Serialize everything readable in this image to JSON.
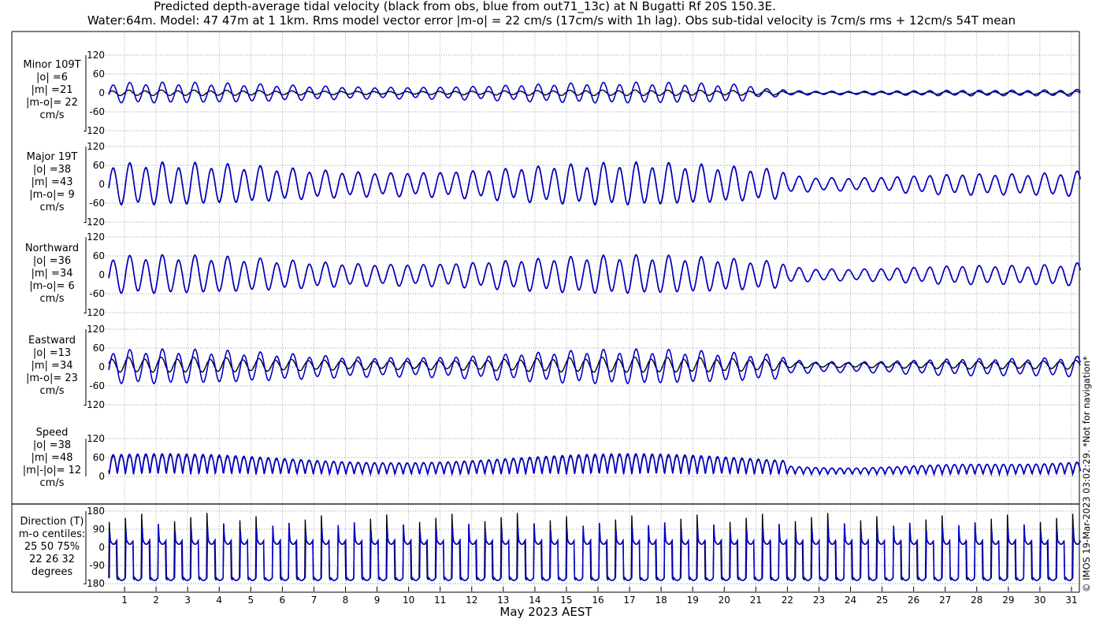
{
  "title_line1": "Predicted depth-average tidal velocity (black from obs, blue from out71_13c) at N Bugatti Rf 20S 150.3E.",
  "title_line2": "Water:64m. Model: 47 47m at 1 1km. Rms model vector error |m-o| = 22 cm/s (17cm/s with 1h lag). Obs sub-tidal velocity is 7cm/s rms + 12cm/s 54T mean",
  "xlabel": "May 2023 AEST",
  "copyright": "© IMOS 19-Mar-2023 03:02:29. *Not for navigation*",
  "colors": {
    "obs": "#000000",
    "model": "#0000cc",
    "grid": "#777777"
  },
  "panels": [
    {
      "label_lines": [
        "Minor 109T",
        "|o| =6",
        "|m| =21",
        "|m-o|= 22",
        "cm/s"
      ]
    },
    {
      "label_lines": [
        "Major 19T",
        "|o| =38",
        "|m| =43",
        "|m-o|= 9",
        "cm/s"
      ]
    },
    {
      "label_lines": [
        "Northward",
        "|o| =36",
        "|m| =34",
        "|m-o|= 6",
        "cm/s"
      ]
    },
    {
      "label_lines": [
        "Eastward",
        "|o| =13",
        "|m| =34",
        "|m-o|= 23",
        "cm/s"
      ]
    },
    {
      "label_lines": [
        "Speed",
        "|o| =38",
        "|m| =48",
        "|m|-|o|= 12",
        "cm/s"
      ]
    },
    {
      "label_lines": [
        "Direction (T)",
        "m-o centiles:",
        "25  50  75%",
        "22  26  32",
        "degrees"
      ]
    }
  ],
  "chart_data": [
    {
      "type": "line",
      "name": "minor",
      "x_ticks": [
        1,
        2,
        3,
        4,
        5,
        6,
        7,
        8,
        9,
        10,
        11,
        12,
        13,
        14,
        15,
        16,
        17,
        18,
        19,
        20,
        21,
        22,
        23,
        24,
        25,
        26,
        27,
        28,
        29,
        30,
        31
      ],
      "xlim": [
        0.4,
        31.3
      ],
      "ylim": [
        -120,
        120
      ],
      "y_ticks": [
        120,
        60,
        0,
        -60,
        -120
      ],
      "series": [
        {
          "name": "obs",
          "amplitude": 8
        },
        {
          "name": "model",
          "amplitude": 30
        }
      ],
      "grid": true
    },
    {
      "type": "line",
      "name": "major",
      "x_ticks": [
        1,
        2,
        3,
        4,
        5,
        6,
        7,
        8,
        9,
        10,
        11,
        12,
        13,
        14,
        15,
        16,
        17,
        18,
        19,
        20,
        21,
        22,
        23,
        24,
        25,
        26,
        27,
        28,
        29,
        30,
        31
      ],
      "xlim": [
        0.4,
        31.3
      ],
      "ylim": [
        -120,
        120
      ],
      "y_ticks": [
        120,
        60,
        0,
        -60,
        -120
      ],
      "series": [
        {
          "name": "obs",
          "amplitude": 60
        },
        {
          "name": "model",
          "amplitude": 62
        }
      ],
      "grid": true
    },
    {
      "type": "line",
      "name": "northward",
      "x_ticks": [
        1,
        2,
        3,
        4,
        5,
        6,
        7,
        8,
        9,
        10,
        11,
        12,
        13,
        14,
        15,
        16,
        17,
        18,
        19,
        20,
        21,
        22,
        23,
        24,
        25,
        26,
        27,
        28,
        29,
        30,
        31
      ],
      "xlim": [
        0.4,
        31.3
      ],
      "ylim": [
        -120,
        120
      ],
      "y_ticks": [
        120,
        60,
        0,
        -60,
        -120
      ],
      "series": [
        {
          "name": "obs",
          "amplitude": 56
        },
        {
          "name": "model",
          "amplitude": 55
        }
      ],
      "grid": true
    },
    {
      "type": "line",
      "name": "eastward",
      "x_ticks": [
        1,
        2,
        3,
        4,
        5,
        6,
        7,
        8,
        9,
        10,
        11,
        12,
        13,
        14,
        15,
        16,
        17,
        18,
        19,
        20,
        21,
        22,
        23,
        24,
        25,
        26,
        27,
        28,
        29,
        30,
        31
      ],
      "xlim": [
        0.4,
        31.3
      ],
      "ylim": [
        -120,
        120
      ],
      "y_ticks": [
        120,
        60,
        0,
        -60,
        -120
      ],
      "series": [
        {
          "name": "obs",
          "amplitude": 22
        },
        {
          "name": "model",
          "amplitude": 50
        }
      ],
      "grid": true
    },
    {
      "type": "line",
      "name": "speed",
      "x_ticks": [
        1,
        2,
        3,
        4,
        5,
        6,
        7,
        8,
        9,
        10,
        11,
        12,
        13,
        14,
        15,
        16,
        17,
        18,
        19,
        20,
        21,
        22,
        23,
        24,
        25,
        26,
        27,
        28,
        29,
        30,
        31
      ],
      "xlim": [
        0.4,
        31.3
      ],
      "ylim": [
        0,
        120
      ],
      "y_ticks": [
        120,
        60,
        0
      ],
      "series": [
        {
          "name": "obs",
          "amplitude": 60
        },
        {
          "name": "model",
          "amplitude": 66
        }
      ],
      "grid": true
    },
    {
      "type": "line",
      "name": "direction",
      "x_ticks": [
        1,
        2,
        3,
        4,
        5,
        6,
        7,
        8,
        9,
        10,
        11,
        12,
        13,
        14,
        15,
        16,
        17,
        18,
        19,
        20,
        21,
        22,
        23,
        24,
        25,
        26,
        27,
        28,
        29,
        30,
        31
      ],
      "xlim": [
        0.4,
        31.3
      ],
      "ylim": [
        -180,
        180
      ],
      "y_ticks": [
        180,
        90,
        0,
        -90,
        -180
      ],
      "series": [
        {
          "name": "obs"
        },
        {
          "name": "model"
        }
      ],
      "grid": true
    }
  ]
}
